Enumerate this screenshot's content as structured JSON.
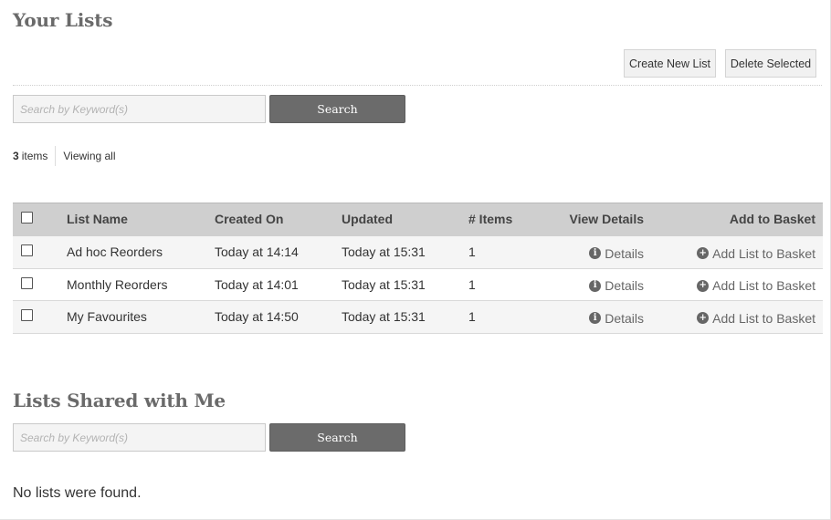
{
  "your_lists": {
    "title": "Your Lists",
    "create_button": "Create New List",
    "delete_button": "Delete Selected",
    "search": {
      "placeholder": "Search by Keyword(s)",
      "button": "Search"
    },
    "count": {
      "number": "3",
      "unit": "items",
      "viewing": "Viewing all"
    },
    "table": {
      "headers": {
        "name": "List Name",
        "created": "Created On",
        "updated": "Updated",
        "items": "# Items",
        "view": "View Details",
        "basket": "Add to Basket"
      },
      "rows": [
        {
          "name": "Ad hoc Reorders",
          "created": "Today at 14:14",
          "updated": "Today at 15:31",
          "items": "1",
          "details": "Details",
          "add": "Add List to Basket"
        },
        {
          "name": "Monthly Reorders",
          "created": "Today at 14:01",
          "updated": "Today at 15:31",
          "items": "1",
          "details": "Details",
          "add": "Add List to Basket"
        },
        {
          "name": "My Favourites",
          "created": "Today at 14:50",
          "updated": "Today at 15:31",
          "items": "1",
          "details": "Details",
          "add": "Add List to Basket"
        }
      ]
    }
  },
  "shared_lists": {
    "title": "Lists Shared with Me",
    "search": {
      "placeholder": "Search by Keyword(s)",
      "button": "Search"
    },
    "empty_message": "No lists were found."
  },
  "icons": {
    "info": "info-circle-icon",
    "add": "plus-circle-icon"
  },
  "colors": {
    "heading": "#6a6a6a",
    "search_button": "#6b6b6b",
    "table_header": "#cfcfcf"
  }
}
